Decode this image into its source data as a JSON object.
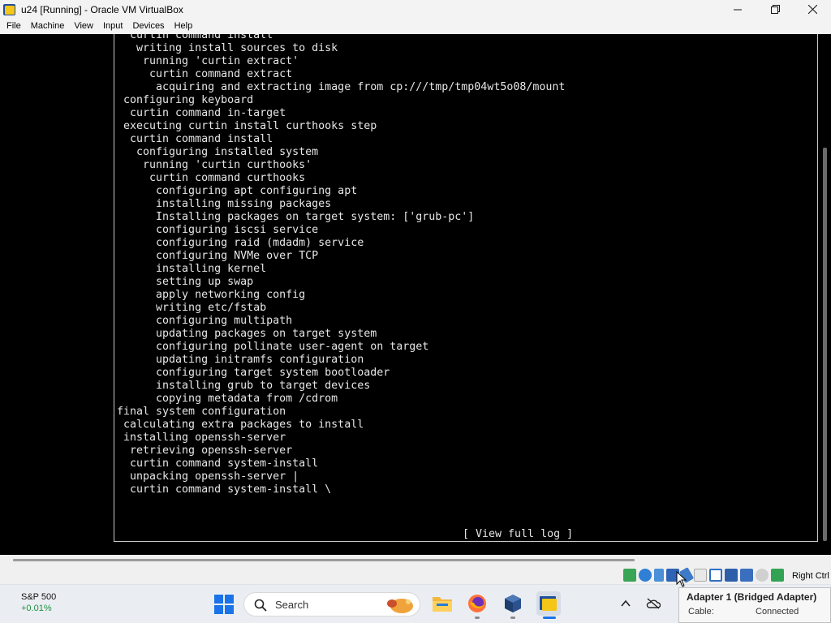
{
  "window": {
    "title": "u24 [Running] - Oracle VM VirtualBox",
    "minimize_glyph": "—",
    "maximize_glyph": "❐",
    "close_glyph": "✕"
  },
  "menu": {
    "items": [
      "File",
      "Machine",
      "View",
      "Input",
      "Devices",
      "Help"
    ]
  },
  "console": {
    "lines": [
      "  curtin command install",
      "   writing install sources to disk",
      "    running 'curtin extract'",
      "     curtin command extract",
      "      acquiring and extracting image from cp:///tmp/tmp04wt5o08/mount",
      " configuring keyboard",
      "  curtin command in-target",
      " executing curtin install curthooks step",
      "  curtin command install",
      "   configuring installed system",
      "    running 'curtin curthooks'",
      "     curtin command curthooks",
      "      configuring apt configuring apt",
      "      installing missing packages",
      "      Installing packages on target system: ['grub-pc']",
      "      configuring iscsi service",
      "      configuring raid (mdadm) service",
      "      configuring NVMe over TCP",
      "      installing kernel",
      "      setting up swap",
      "      apply networking config",
      "      writing etc/fstab",
      "      configuring multipath",
      "      updating packages on target system",
      "      configuring pollinate user-agent on target",
      "      updating initramfs configuration",
      "      configuring target system bootloader",
      "      installing grub to target devices",
      "      copying metadata from /cdrom",
      "final system configuration",
      " calculating extra packages to install",
      " installing openssh-server",
      "  retrieving openssh-server",
      "  curtin command system-install",
      "  unpacking openssh-server |",
      "  curtin command system-install \\"
    ],
    "view_log_label": "[ View full log ]"
  },
  "statusbar": {
    "host_key_label": "Right Ctrl",
    "icons": [
      "hard-disk-icon",
      "optical-drive-icon",
      "audio-icon",
      "network-icon",
      "usb-icon",
      "shared-folders-icon",
      "display-icon",
      "recording-icon",
      "cpu-icon",
      "mouse-integration-icon",
      "host-key-icon"
    ]
  },
  "taskbar": {
    "widget_title": "S&P 500",
    "widget_value": "+0.01%",
    "search_placeholder": "Search",
    "apps": [
      "file-explorer",
      "firefox",
      "virtualbox-manager",
      "virtualbox-vm"
    ]
  },
  "tooltip": {
    "title": "Adapter 1 (Bridged Adapter)",
    "cable_label": "Cable:",
    "cable_value": "Connected"
  },
  "colors": {
    "console_bg": "#000000",
    "console_text": "#e6e6e6",
    "widget_positive": "#1f8f3a",
    "accent": "#1a73e8"
  }
}
